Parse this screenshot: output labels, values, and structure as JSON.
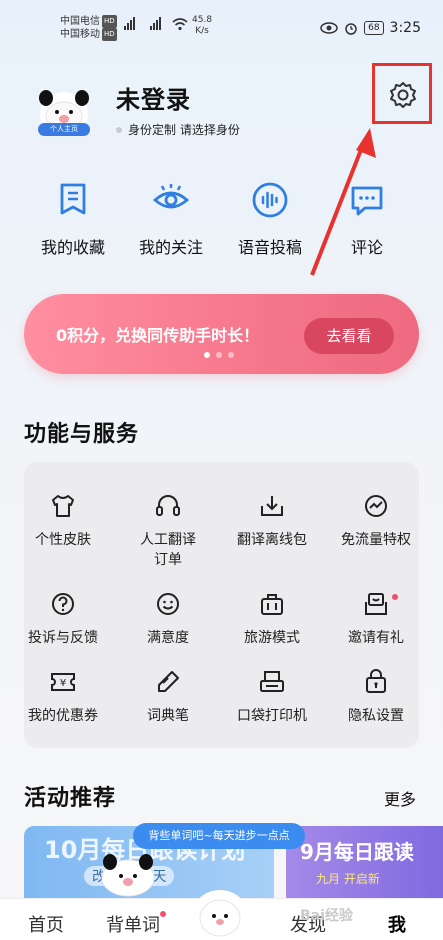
{
  "status_bar": {
    "carrier1": "中国电信",
    "carrier2": "中国移动",
    "hd": "HD",
    "net_speed": "45.8",
    "net_unit": "K/s",
    "battery": "68",
    "time": "3:25"
  },
  "profile": {
    "name": "未登录",
    "badge": "个人主页",
    "identity_text": "身份定制 请选择身份"
  },
  "quick_actions": [
    {
      "label": "我的收藏",
      "icon": "bookmark-icon"
    },
    {
      "label": "我的关注",
      "icon": "eye-icon"
    },
    {
      "label": "语音投稿",
      "icon": "voice-icon"
    },
    {
      "label": "评论",
      "icon": "comment-icon"
    }
  ],
  "banner": {
    "text": "0积分，兑换同传助手时长！",
    "button": "去看看"
  },
  "services": {
    "title": "功能与服务",
    "items": [
      {
        "label": "个性皮肤",
        "icon": "tshirt-icon"
      },
      {
        "label": "人工翻译\n订单",
        "icon": "headset-icon"
      },
      {
        "label": "翻译离线包",
        "icon": "download-icon"
      },
      {
        "label": "免流量特权",
        "icon": "traffic-icon"
      },
      {
        "label": "投诉与反馈",
        "icon": "question-icon"
      },
      {
        "label": "满意度",
        "icon": "smile-icon"
      },
      {
        "label": "旅游模式",
        "icon": "luggage-icon"
      },
      {
        "label": "邀请有礼",
        "icon": "invite-icon"
      },
      {
        "label": "我的优惠券",
        "icon": "coupon-icon"
      },
      {
        "label": "词典笔",
        "icon": "pen-icon"
      },
      {
        "label": "口袋打印机",
        "icon": "printer-icon"
      },
      {
        "label": "隐私设置",
        "icon": "lock-icon"
      }
    ]
  },
  "activities": {
    "title": "活动推荐",
    "more": "更多",
    "card1_title": "10月每日跟读计划",
    "card1_sub": "改 开启明天",
    "card2_title": "9月每日跟读",
    "card2_sub": "九月  开启新",
    "tooltip": "背些单词吧~每天进步一点点"
  },
  "tabs": [
    "首页",
    "背单词",
    "发现",
    "我"
  ],
  "watermark": "Bai经验",
  "colors": {
    "accent": "#2f7fe3",
    "highlight": "#e8322f",
    "banner": "#f77a8e"
  }
}
